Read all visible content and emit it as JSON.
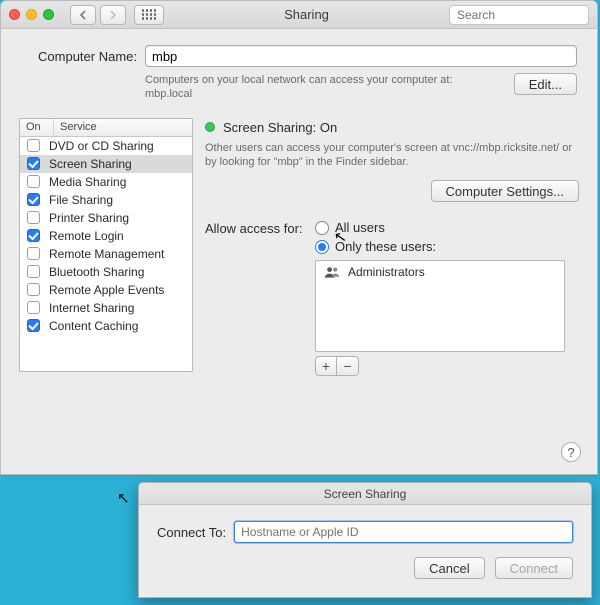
{
  "window": {
    "title": "Sharing",
    "search_placeholder": "Search"
  },
  "computer_name": {
    "label": "Computer Name:",
    "value": "mbp",
    "hint_line1": "Computers on your local network can access your computer at:",
    "hint_line2": "mbp.local",
    "edit_button": "Edit..."
  },
  "services": {
    "header_on": "On",
    "header_service": "Service",
    "items": [
      {
        "label": "DVD or CD Sharing",
        "on": false,
        "selected": false
      },
      {
        "label": "Screen Sharing",
        "on": true,
        "selected": true
      },
      {
        "label": "Media Sharing",
        "on": false,
        "selected": false
      },
      {
        "label": "File Sharing",
        "on": true,
        "selected": false
      },
      {
        "label": "Printer Sharing",
        "on": false,
        "selected": false
      },
      {
        "label": "Remote Login",
        "on": true,
        "selected": false
      },
      {
        "label": "Remote Management",
        "on": false,
        "selected": false
      },
      {
        "label": "Bluetooth Sharing",
        "on": false,
        "selected": false
      },
      {
        "label": "Remote Apple Events",
        "on": false,
        "selected": false
      },
      {
        "label": "Internet Sharing",
        "on": false,
        "selected": false
      },
      {
        "label": "Content Caching",
        "on": true,
        "selected": false
      }
    ]
  },
  "detail": {
    "status_label": "Screen Sharing: On",
    "hint": "Other users can access your computer's screen at vnc://mbp.ricksite.net/ or by looking for \"mbp\" in the Finder sidebar.",
    "computer_settings_button": "Computer Settings...",
    "allow_access_label": "Allow access for:",
    "options": {
      "all": "All users",
      "only": "Only these users:"
    },
    "users": [
      "Administrators"
    ],
    "plus": "+",
    "minus": "−"
  },
  "help_label": "?",
  "sheet": {
    "title": "Screen Sharing",
    "connect_label": "Connect To:",
    "placeholder": "Hostname or Apple ID",
    "cancel": "Cancel",
    "connect": "Connect"
  }
}
